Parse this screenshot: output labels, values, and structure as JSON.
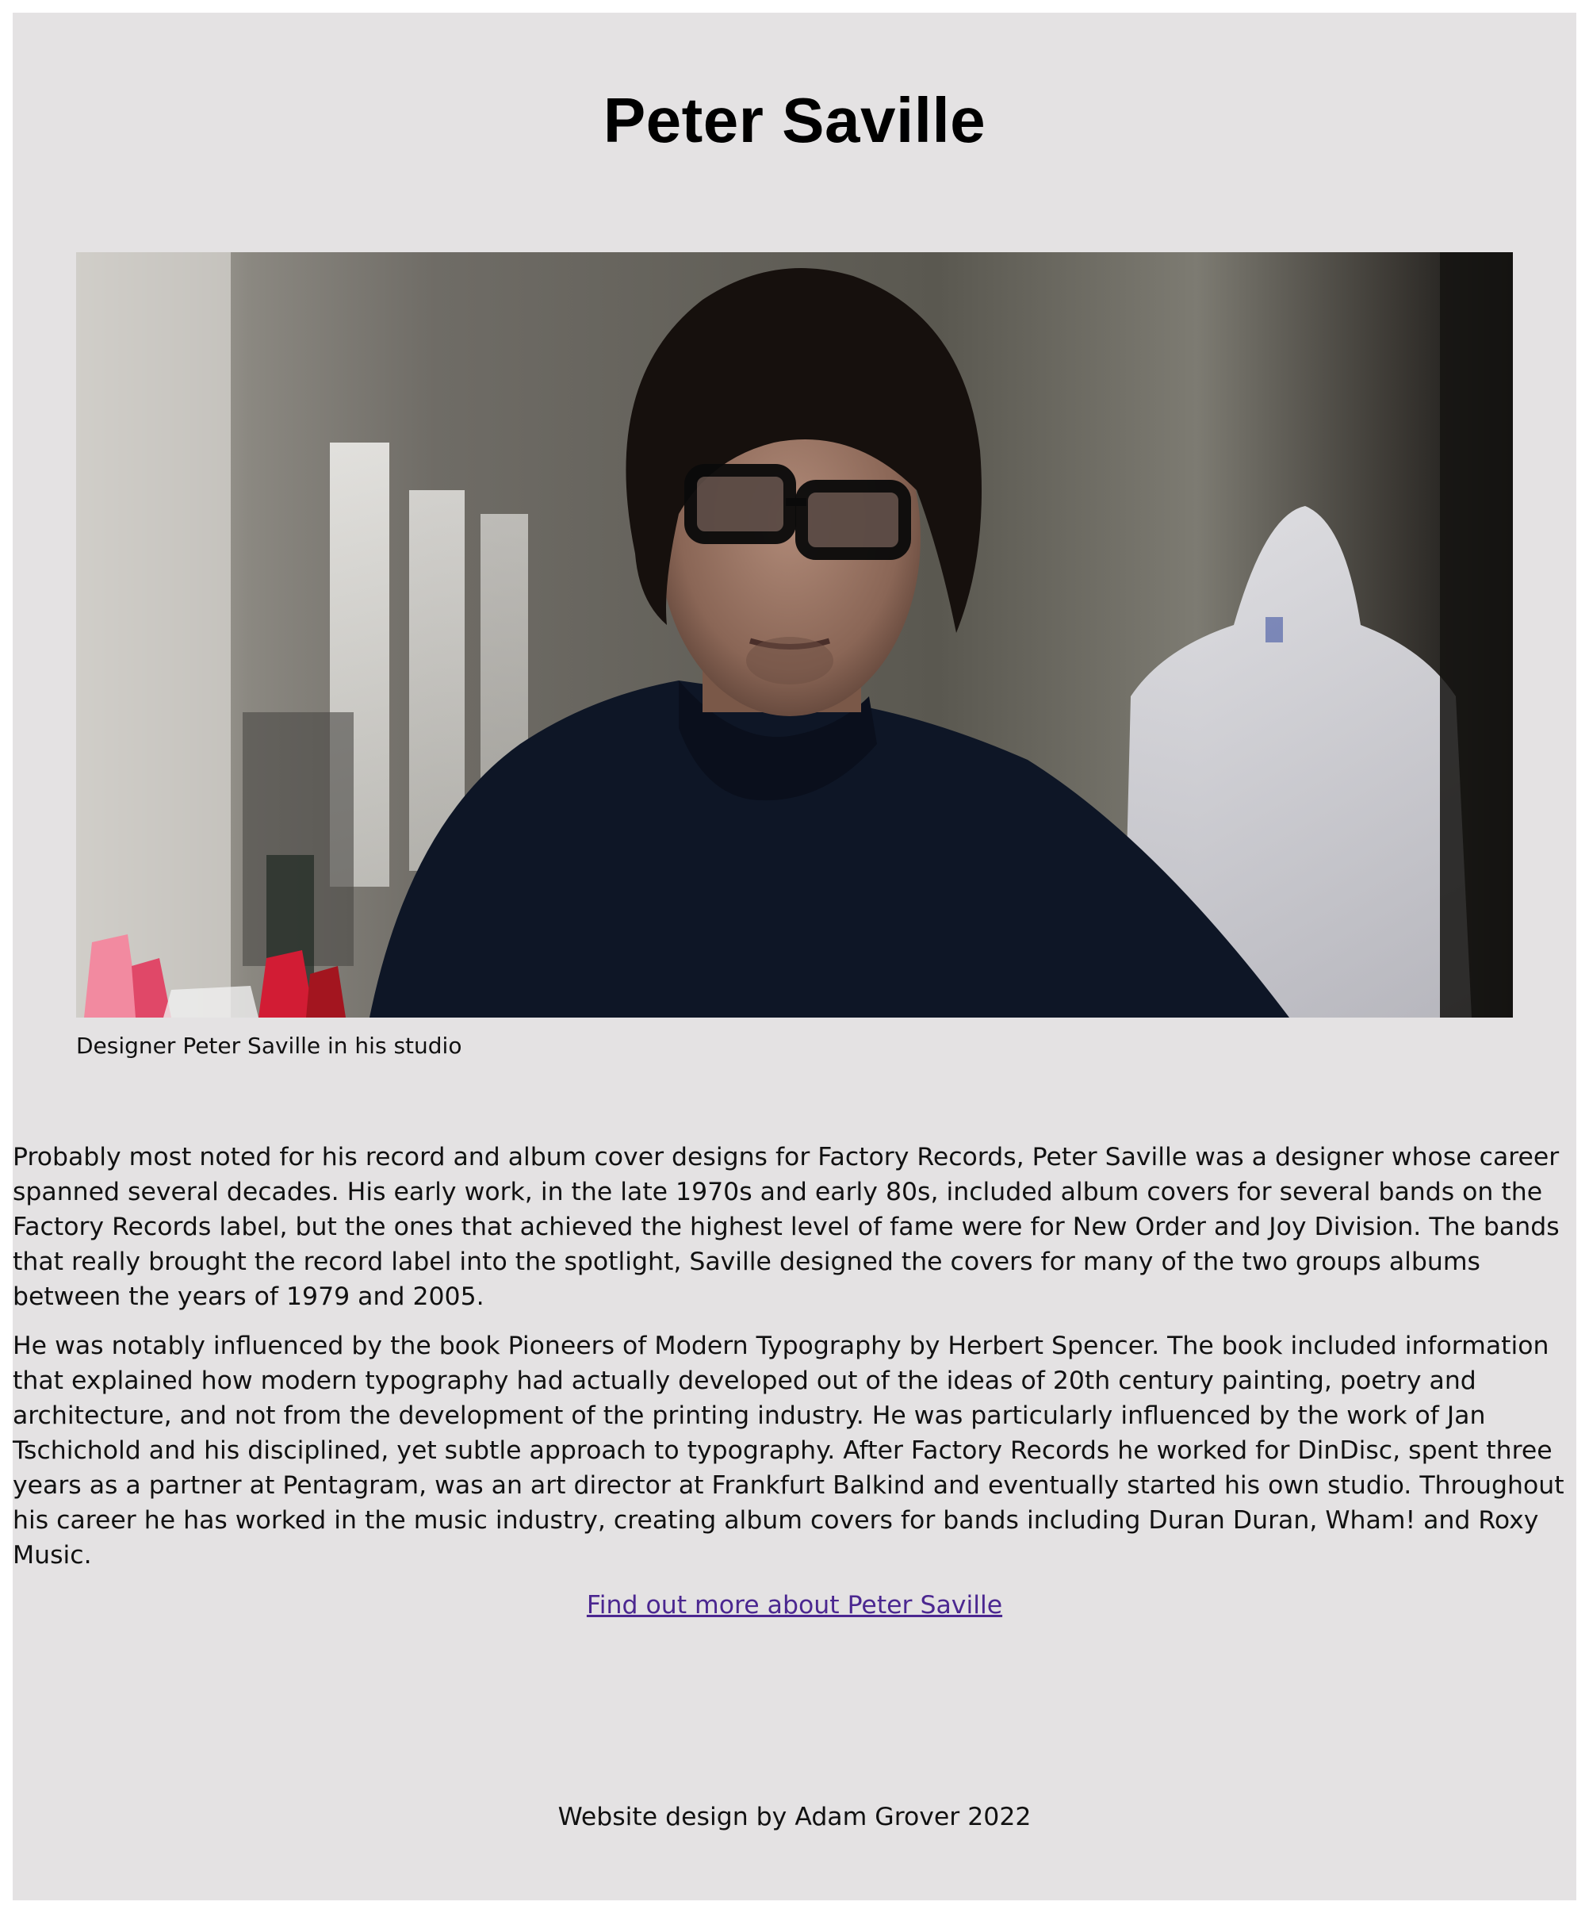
{
  "page": {
    "title": "Peter Saville",
    "background_color": "#e4e2e3",
    "link_color": "#4b2790"
  },
  "figure": {
    "image_alt": "Designer Peter Saville in his studio",
    "caption": "Designer Peter Saville in his studio"
  },
  "article": {
    "paragraphs": [
      "Probably most noted for his record and album cover designs for Factory Records, Peter Saville was a designer whose career spanned several decades. His early work, in the late 1970s and early 80s, included album covers for several bands on the Factory Records label, but the ones that achieved the highest level of fame were for New Order and Joy Division. The bands that really brought the record label into the spotlight, Saville designed the covers for many of the two groups albums between the years of 1979 and 2005.",
      "He was notably influenced by the book Pioneers of Modern Typography by Herbert Spencer. The book included information that explained how modern typography had actually developed out of the ideas of 20th century painting, poetry and architecture, and not from the development of the printing industry. He was particularly influenced by the work of Jan Tschichold and his disciplined, yet subtle approach to typography. After Factory Records he worked for DinDisc, spent three years as a partner at Pentagram, was an art director at Frankfurt Balkind and eventually started his own studio. Throughout his career he has worked in the music industry, creating album covers for bands including Duran Duran, Wham! and Roxy Music."
    ]
  },
  "more_link": {
    "label": "Find out more about Peter Saville"
  },
  "footer": {
    "text": "Website design by Adam Grover 2022"
  }
}
